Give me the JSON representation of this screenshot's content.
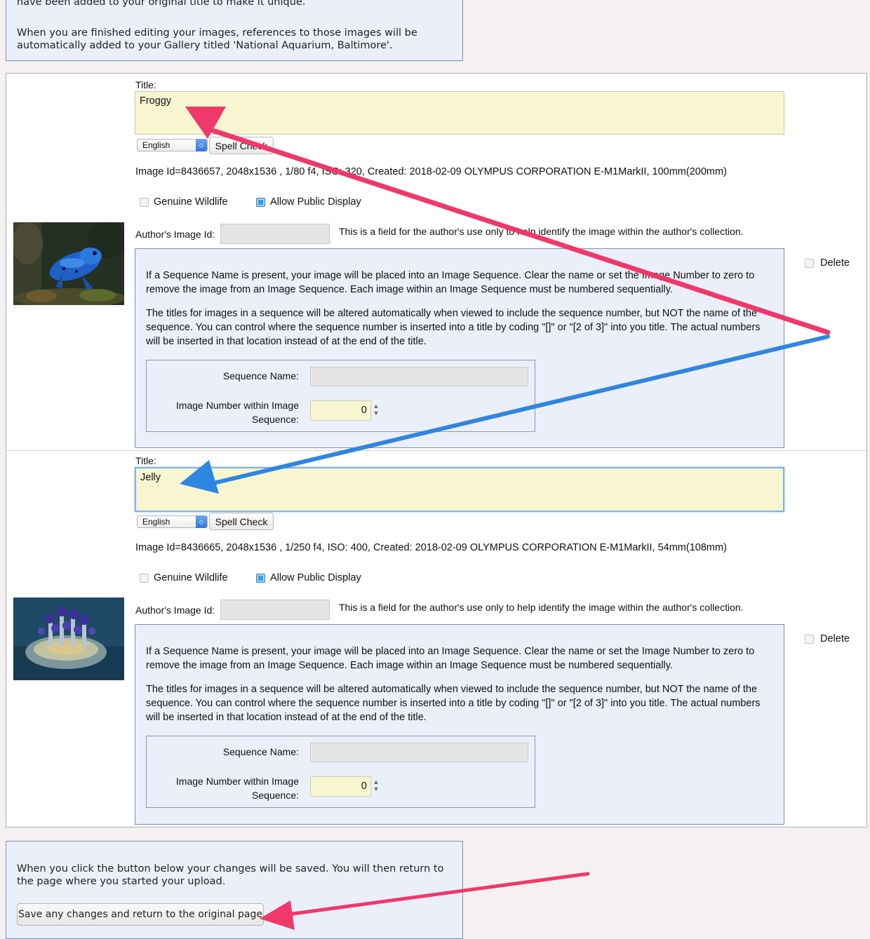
{
  "top_notice": {
    "line_cut": "have been added to your original title to make it unique.",
    "finish_text": "When you are finished editing your images, references to those images will be automatically added to your Gallery titled 'National Aquarium, Baltimore'."
  },
  "labels": {
    "title": "Title:",
    "language": "English",
    "spell_check": "Spell Check",
    "genuine_wildlife": "Genuine Wildlife",
    "allow_public_display": "Allow Public Display",
    "authors_image_id": "Author's Image Id:",
    "author_help": "This is a field for the author's use only to help identify the image within the author's collection.",
    "delete": "Delete",
    "seq_para1": "If a Sequence Name is present, your image will be placed into an Image Sequence. Clear the name or set the Image Number to zero to remove the image from an Image Sequence. Each image within an Image Sequence must be numbered sequentially.",
    "seq_para2": "The titles for images in a sequence will be altered automatically when viewed to include the sequence number, but NOT the name of the sequence. You can control where the sequence number is inserted into a title by coding \"[]\" or \"[2 of 3]\" into you title. The actual numbers will be inserted in that location instead of at the end of the title.",
    "sequence_name": "Sequence Name:",
    "image_number_line1": "Image Number within Image",
    "image_number_line2": "Sequence:"
  },
  "images": [
    {
      "title": "Froggy",
      "meta": "Image Id=8436657, 2048x1536 , 1/80 f4, ISO: 320, Created: 2018-02-09 OLYMPUS CORPORATION E-M1MarkII, 100mm(200mm)",
      "genuine_wildlife": false,
      "allow_public_display": true,
      "authors_image_id": "",
      "sequence_name": "",
      "image_number": "0",
      "delete": false
    },
    {
      "title": "Jelly",
      "meta": "Image Id=8436665, 2048x1536 , 1/250 f4, ISO: 400, Created: 2018-02-09 OLYMPUS CORPORATION E-M1MarkII, 54mm(108mm)",
      "genuine_wildlife": false,
      "allow_public_display": true,
      "authors_image_id": "",
      "sequence_name": "",
      "image_number": "0",
      "delete": false
    }
  ],
  "bottom_notice": {
    "text": "When you click the button below your changes will be saved. You will then return to the page where you started your upload.",
    "save_button": "Save any changes and return to the original page"
  },
  "colors": {
    "annotation_pink": "#f0386b",
    "annotation_blue": "#2f86e0",
    "title_field_bg": "#f8f6d1",
    "panel_bg": "#eaeffa"
  }
}
